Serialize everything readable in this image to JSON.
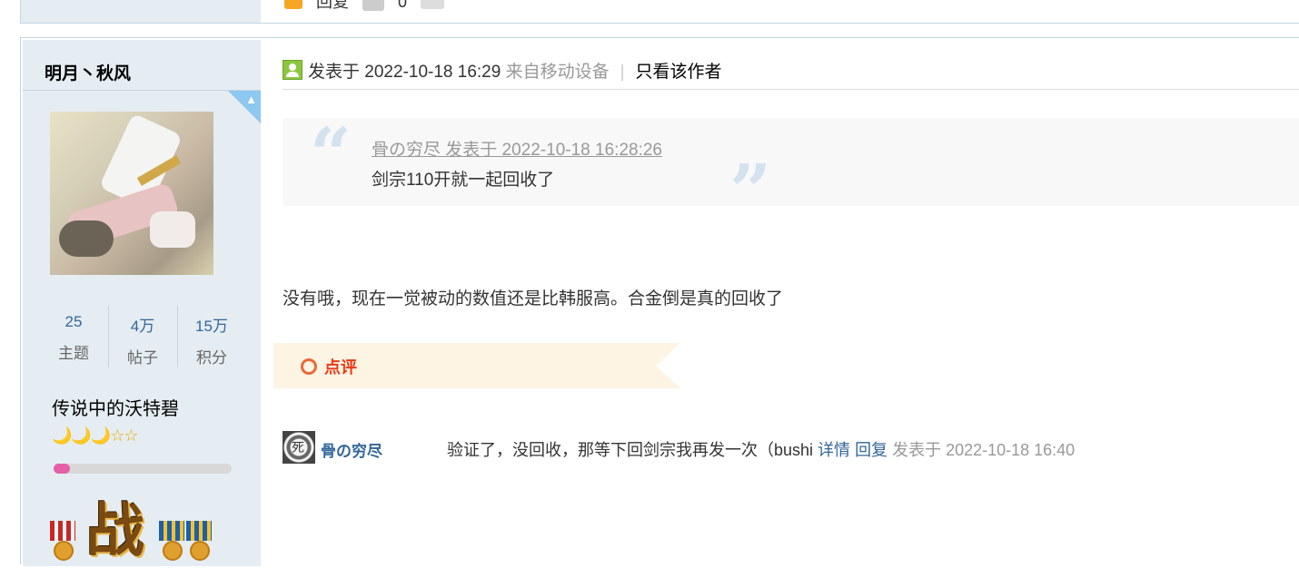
{
  "top_post": {
    "reply_label": "回复",
    "like_count": "0"
  },
  "author": {
    "name": "明月丶秋风",
    "stats": [
      {
        "value": "25",
        "label": "主题"
      },
      {
        "value": "4万",
        "label": "帖子"
      },
      {
        "value": "15万",
        "label": "积分"
      }
    ],
    "rank_title": "传说中的沃特碧",
    "rank_icons": "🌙🌙🌙☆☆",
    "level_progress": 0.09,
    "medal_text": "战"
  },
  "post": {
    "posted_prefix": "发表于",
    "posted_time": "2022-10-18 16:29",
    "device": "来自移动设备",
    "separator": "|",
    "author_only": "只看该作者",
    "quote": {
      "source": "骨の穷尽 发表于 2022-10-18 16:28:26",
      "text": "剑宗110开就一起回收了",
      "open_mark": "“",
      "close_mark": "”"
    },
    "body": "没有哦，现在一觉被动的数值还是比韩服高。合金倒是真的回收了",
    "comment_section_label": "点评",
    "comments": [
      {
        "user": "骨の穷尽",
        "avatar_char": "死",
        "text": "验证了，没回收，那等下回剑宗我再发一次（bushi",
        "detail_link": "详情",
        "reply_link": "回复",
        "time": "发表于 2022-10-18 16:40"
      }
    ]
  },
  "colors": {
    "sidebar_bg": "#e5edf2",
    "link_blue": "#336699",
    "accent_red": "#e83a1a",
    "banner_bg": "#fdf4e3"
  }
}
